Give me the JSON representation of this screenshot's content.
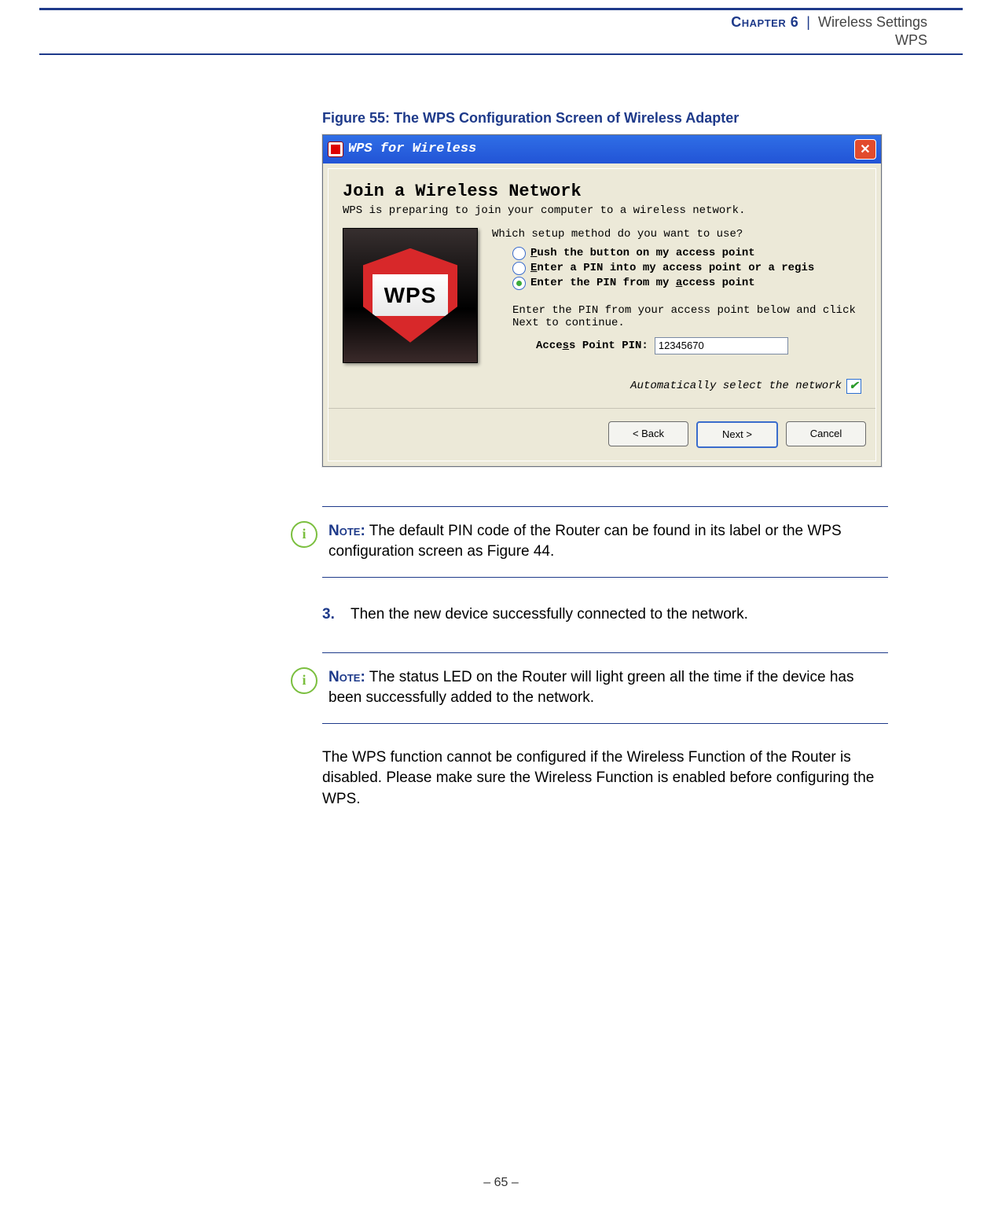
{
  "header": {
    "chapter_label": "Chapter 6",
    "separator": "|",
    "line1_tail": "Wireless Settings",
    "line2": "WPS"
  },
  "figure": {
    "caption": "Figure 55:  The WPS Configuration Screen of Wireless Adapter",
    "window_title": "WPS for Wireless",
    "heading": "Join a Wireless Network",
    "subheading": "WPS is preparing to join your computer to a wireless network.",
    "logo_text": "WPS",
    "question": "Which setup method do you want to use?",
    "options": {
      "opt1_pre": "P",
      "opt1_rest": "ush the button on my access point",
      "opt2_pre": "E",
      "opt2_rest": "nter a PIN into my access point or a regis",
      "opt3_head": "Enter the PIN from my ",
      "opt3_u": "a",
      "opt3_tail": "ccess point"
    },
    "hint": "Enter the PIN from your access point below and click Next to continue.",
    "pin_label_head": "Acce",
    "pin_label_u": "s",
    "pin_label_tail": "s Point PIN:",
    "pin_value": "12345670",
    "auto_net_label": "Automatically select the network",
    "buttons": {
      "back": "< Back",
      "next": "Next >",
      "cancel": "Cancel"
    }
  },
  "notes": {
    "label": "Note:",
    "note1": "The default PIN code of the Router can be found in its label or the WPS configuration screen as Figure 44.",
    "note2": "The status LED on the Router will light green all the time if the device has been successfully added to the network."
  },
  "step": {
    "number": "3.",
    "text": "Then the new device successfully connected to the network."
  },
  "paragraph": "The WPS function cannot be configured if the Wireless Function of the Router is disabled. Please make sure the Wireless Function is enabled before configuring the WPS.",
  "footer": "–  65  –"
}
